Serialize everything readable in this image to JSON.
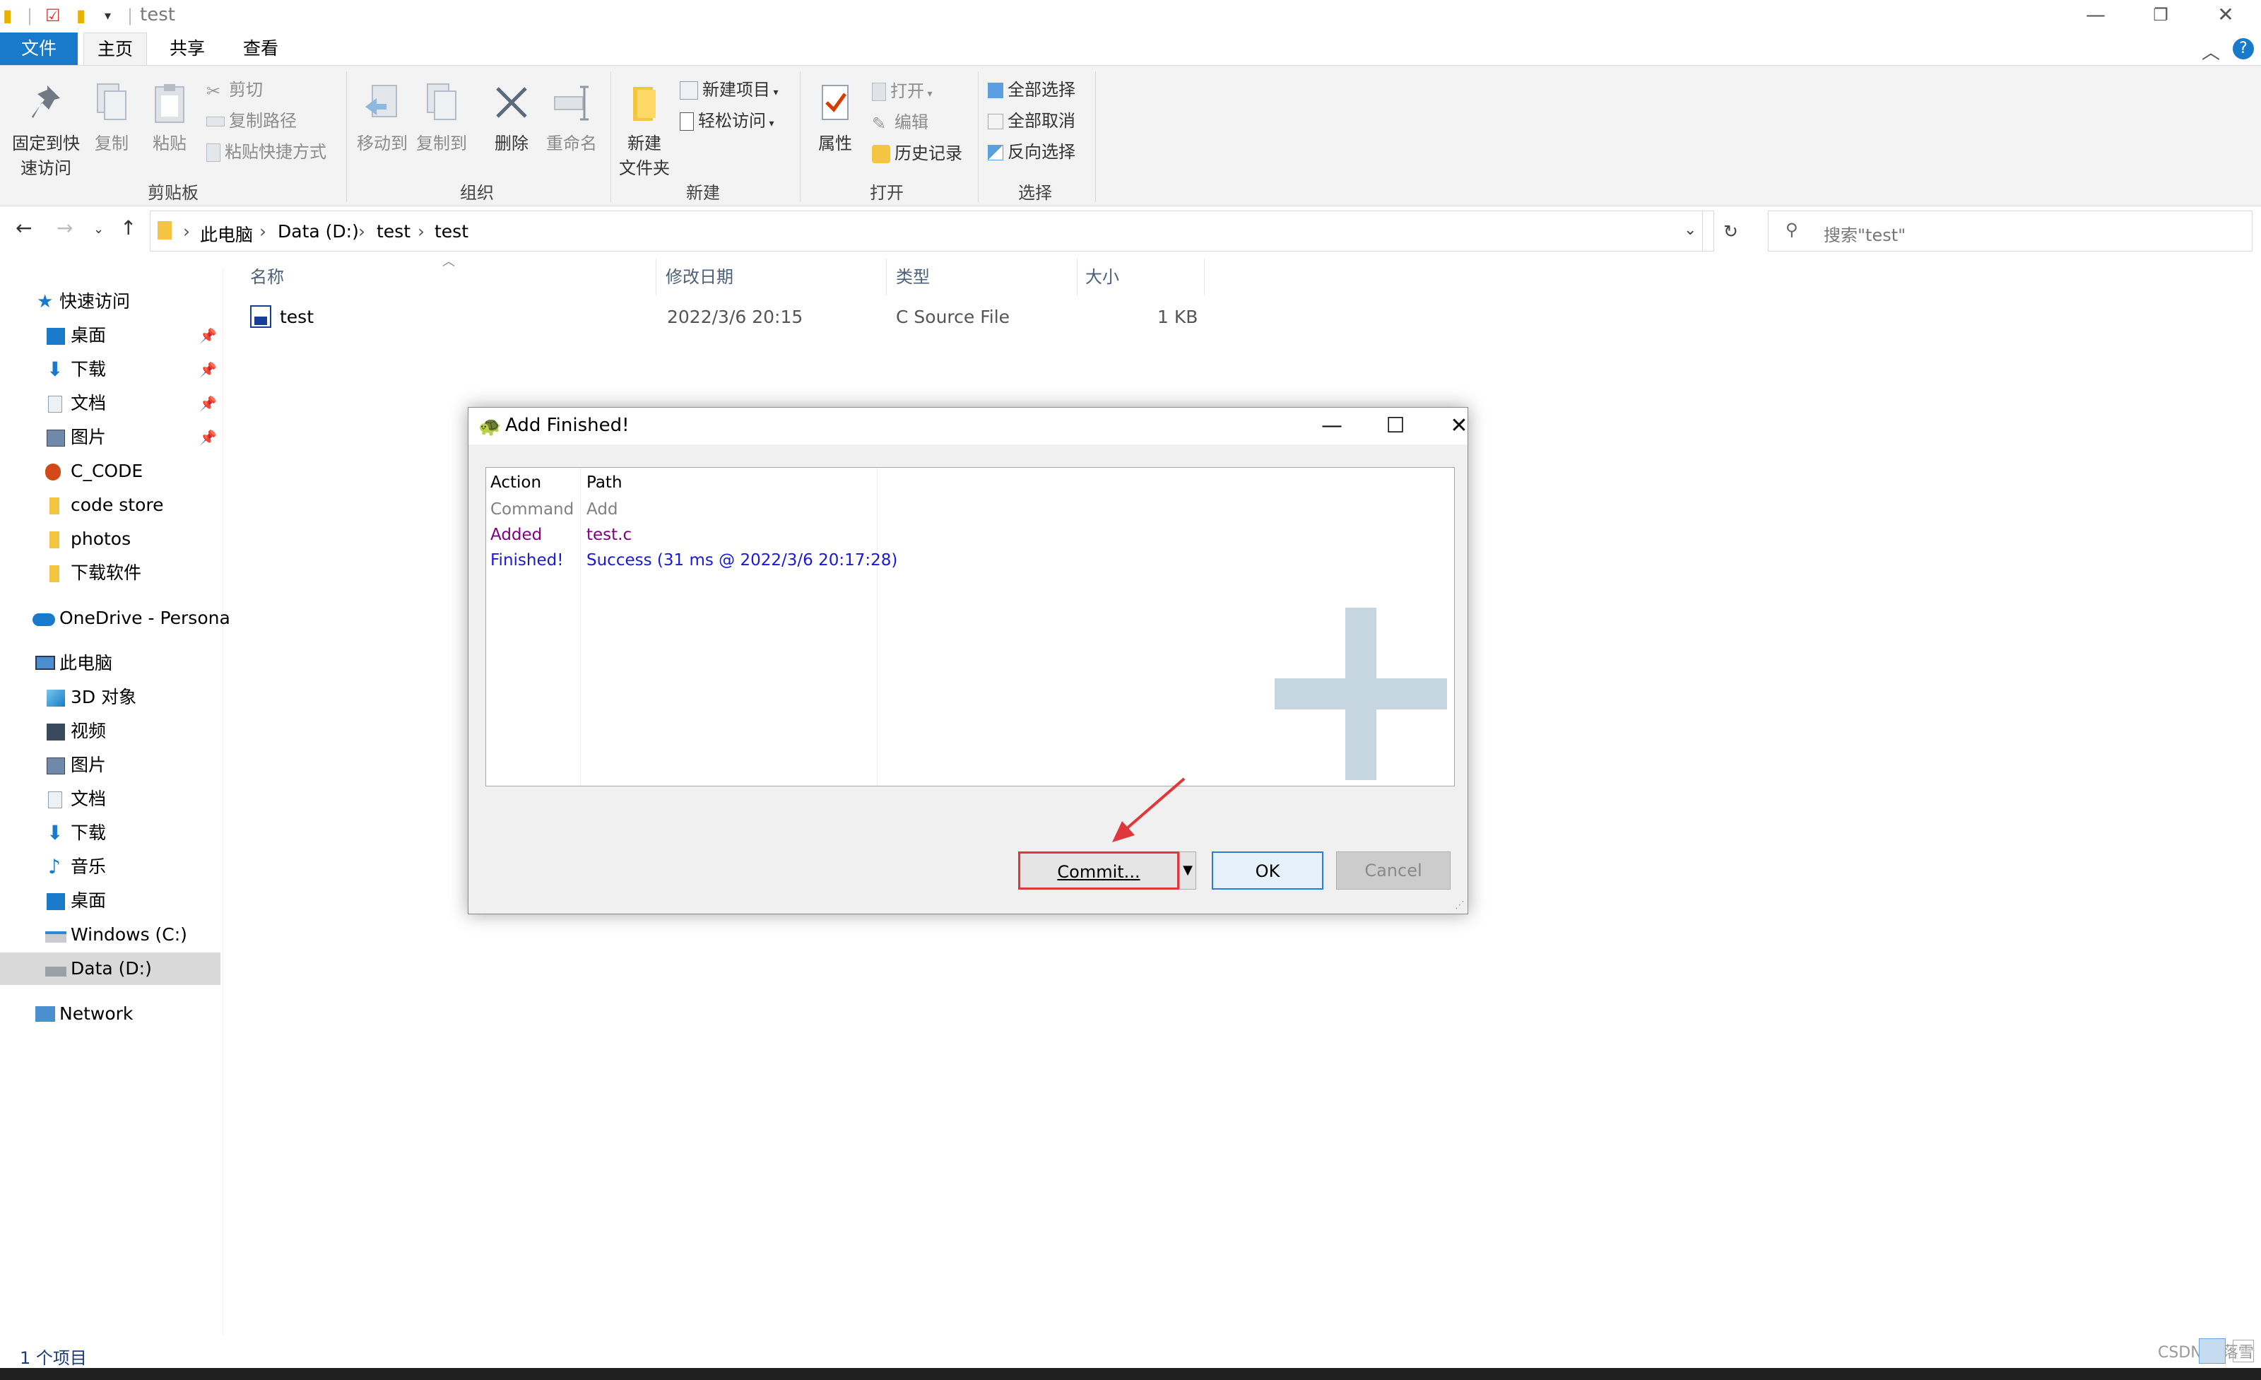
{
  "window": {
    "title": "test"
  },
  "ribbon_tabs": {
    "file": "文件",
    "home": "主页",
    "share": "共享",
    "view": "查看"
  },
  "ribbon": {
    "pin_line1": "固定到快",
    "pin_line2": "速访问",
    "copy": "复制",
    "paste": "粘贴",
    "cut": "剪切",
    "copy_path": "复制路径",
    "paste_shortcut": "粘贴快捷方式",
    "clipboard_group": "剪贴板",
    "move_to": "移动到",
    "copy_to": "复制到",
    "delete": "删除",
    "rename": "重命名",
    "organize_group": "组织",
    "new_folder_line1": "新建",
    "new_folder_line2": "文件夹",
    "new_item": "新建项目",
    "easy_access": "轻松访问",
    "new_group": "新建",
    "properties": "属性",
    "open": "打开",
    "edit": "编辑",
    "history": "历史记录",
    "open_group": "打开",
    "select_all": "全部选择",
    "select_none": "全部取消",
    "invert_selection": "反向选择",
    "select_group": "选择"
  },
  "address": {
    "crumbs": [
      "此电脑",
      "Data (D:)",
      "test",
      "test"
    ],
    "search_placeholder": "搜索\"test\""
  },
  "sidebar": {
    "quick_access": "快速访问",
    "quick_items": [
      "桌面",
      "下载",
      "文档",
      "图片",
      "C_CODE",
      "code store",
      "photos",
      "下载软件"
    ],
    "onedrive": "OneDrive - Persona",
    "this_pc": "此电脑",
    "pc_items": [
      "3D 对象",
      "视频",
      "图片",
      "文档",
      "下载",
      "音乐",
      "桌面",
      "Windows (C:)",
      "Data (D:)"
    ],
    "network": "Network"
  },
  "columns": {
    "name": "名称",
    "modified": "修改日期",
    "type": "类型",
    "size": "大小"
  },
  "files": [
    {
      "name": "test",
      "modified": "2022/3/6 20:15",
      "type": "C Source File",
      "size": "1 KB"
    }
  ],
  "status": {
    "count": "1 个项目"
  },
  "dialog": {
    "title": "Add Finished!",
    "header_action": "Action",
    "header_path": "Path",
    "rows": [
      {
        "action": "Command",
        "path": "Add",
        "color": "#808080"
      },
      {
        "action": "Added",
        "path": "test.c",
        "color": "#800080"
      },
      {
        "action": "Finished!",
        "path": "Success (31 ms @ 2022/3/6 20:17:28)",
        "color": "#1a1ad6"
      }
    ],
    "commit": "Commit...",
    "ok": "OK",
    "cancel": "Cancel"
  },
  "watermark": "CSDN @落雪"
}
